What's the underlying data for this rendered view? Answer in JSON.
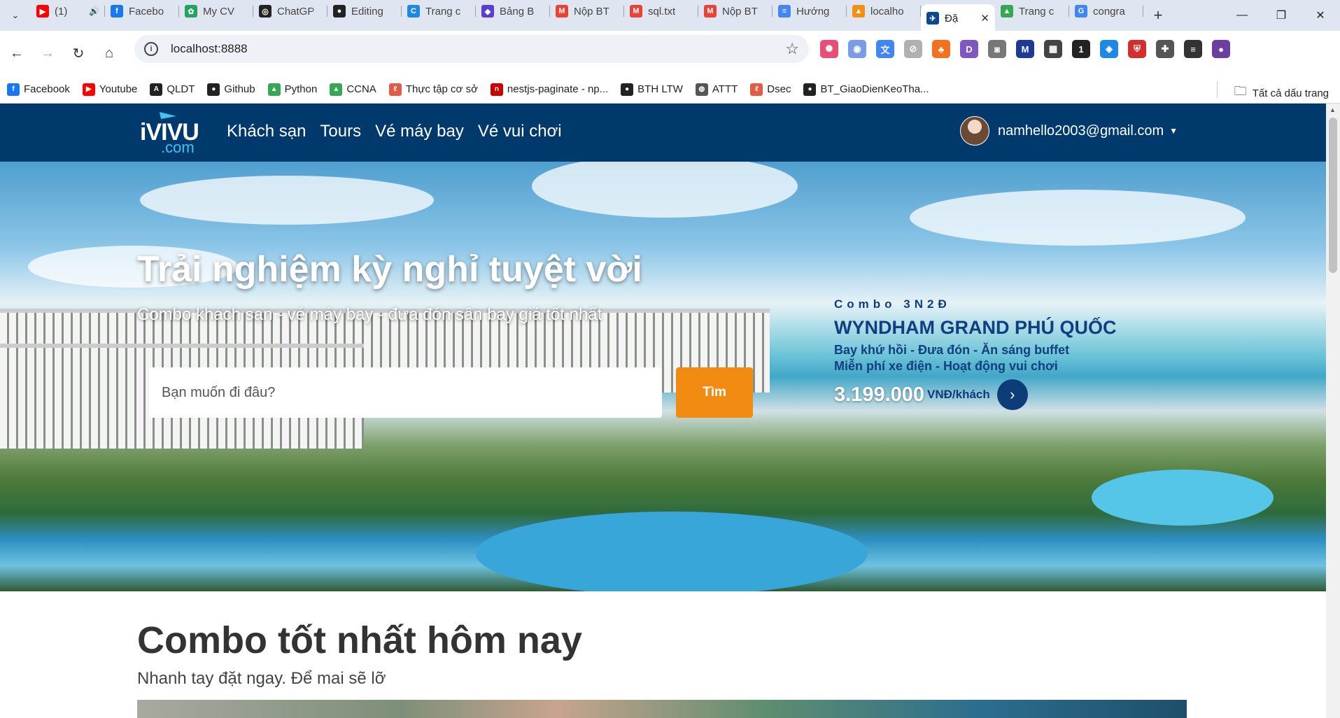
{
  "browser": {
    "tabs": [
      {
        "title": "(1)",
        "icon": "youtube-icon",
        "color": "#ff0000",
        "glyph": "▶",
        "audio": true
      },
      {
        "title": "Facebo",
        "icon": "facebook-icon",
        "color": "#1877f2",
        "glyph": "f"
      },
      {
        "title": "My CV",
        "icon": "leaf-icon",
        "color": "#21a366",
        "glyph": "✿"
      },
      {
        "title": "ChatGP",
        "icon": "chatgpt-icon",
        "color": "#222222",
        "glyph": "◎"
      },
      {
        "title": "Editing",
        "icon": "github-icon",
        "color": "#222222",
        "glyph": "●"
      },
      {
        "title": "Trang c",
        "icon": "canva-icon",
        "color": "#1e88e5",
        "glyph": "C"
      },
      {
        "title": "Bảng B",
        "icon": "app-icon",
        "color": "#5b3fd1",
        "glyph": "◆"
      },
      {
        "title": "Nộp BT",
        "icon": "gmail-icon",
        "color": "#ea4335",
        "glyph": "M"
      },
      {
        "title": "sql.txt",
        "icon": "gmail-icon",
        "color": "#ea4335",
        "glyph": "M"
      },
      {
        "title": "Nộp BT",
        "icon": "gmail-icon",
        "color": "#ea4335",
        "glyph": "M"
      },
      {
        "title": "Hướng",
        "icon": "docs-icon",
        "color": "#4285f4",
        "glyph": "≡"
      },
      {
        "title": "localho",
        "icon": "phpmyadmin-icon",
        "color": "#f29111",
        "glyph": "▲"
      },
      {
        "title": "Đặ",
        "icon": "ivivu-icon",
        "color": "#0b4a8b",
        "glyph": "✈",
        "active": true
      },
      {
        "title": "Trang c",
        "icon": "drive-icon",
        "color": "#34a853",
        "glyph": "▲"
      },
      {
        "title": "congra",
        "icon": "google-icon",
        "color": "#4285f4",
        "glyph": "G"
      }
    ],
    "url": "localhost:8888",
    "extensions": [
      {
        "icon": "color-wheel-icon",
        "color": "#e94e77",
        "glyph": "✺"
      },
      {
        "icon": "lens-icon",
        "color": "#7b9be8",
        "glyph": "◉"
      },
      {
        "icon": "translate-icon",
        "color": "#4285f4",
        "glyph": "文"
      },
      {
        "icon": "compass-icon",
        "color": "#b0b0b0",
        "glyph": "⊘"
      },
      {
        "icon": "fox-icon",
        "color": "#f2711c",
        "glyph": "♣"
      },
      {
        "icon": "d-icon",
        "color": "#7e57c2",
        "glyph": "D"
      },
      {
        "icon": "camera-icon",
        "color": "#777777",
        "glyph": "◙"
      },
      {
        "icon": "m-icon",
        "color": "#1f3a93",
        "glyph": "M"
      },
      {
        "icon": "qr-icon",
        "color": "#444444",
        "glyph": "▦"
      },
      {
        "icon": "inbox-icon",
        "color": "#222222",
        "glyph": "1"
      },
      {
        "icon": "tag-icon",
        "color": "#1e88e5",
        "glyph": "◈"
      },
      {
        "icon": "shield-icon",
        "color": "#d32f2f",
        "glyph": "⛨"
      },
      {
        "icon": "puzzle-icon",
        "color": "#555555",
        "glyph": "✚"
      },
      {
        "icon": "media-icon",
        "color": "#333333",
        "glyph": "≡"
      },
      {
        "icon": "profile-icon",
        "color": "#6a3fa0",
        "glyph": "●"
      }
    ],
    "bookmarks": [
      {
        "label": "Facebook",
        "icon": "facebook-icon",
        "color": "#1877f2",
        "glyph": "f"
      },
      {
        "label": "Youtube",
        "icon": "youtube-icon",
        "color": "#ff0000",
        "glyph": "▶"
      },
      {
        "label": "QLDT",
        "icon": "angular-icon",
        "color": "#222222",
        "glyph": "A"
      },
      {
        "label": "Github",
        "icon": "github-icon",
        "color": "#222222",
        "glyph": "●"
      },
      {
        "label": "Python",
        "icon": "drive-icon",
        "color": "#34a853",
        "glyph": "▲"
      },
      {
        "label": "CCNA",
        "icon": "drive-icon",
        "color": "#34a853",
        "glyph": "▲"
      },
      {
        "label": "Thực tập cơ sở",
        "icon": "quill-icon",
        "color": "#e25b45",
        "glyph": "ℓ"
      },
      {
        "label": "nestjs-paginate - np...",
        "icon": "npm-icon",
        "color": "#cb0000",
        "glyph": "n"
      },
      {
        "label": "BTH LTW",
        "icon": "github-icon",
        "color": "#222222",
        "glyph": "●"
      },
      {
        "label": "ATTT",
        "icon": "globe-icon",
        "color": "#555555",
        "glyph": "◍"
      },
      {
        "label": "Dsec",
        "icon": "quill-icon",
        "color": "#e25b45",
        "glyph": "ℓ"
      },
      {
        "label": "BT_GiaoDienKeoTha...",
        "icon": "github-icon",
        "color": "#222222",
        "glyph": "●"
      }
    ],
    "all_bookmarks": "Tất cả dấu trang"
  },
  "site": {
    "logo_top": "iVIVU",
    "logo_bottom": ".com",
    "nav": [
      "Khách sạn",
      "Tours",
      "Vé máy bay",
      "Vé vui chơi"
    ],
    "user_email": "namhello2003@gmail.com",
    "hero_title": "Trải nghiệm kỳ nghỉ tuyệt vời",
    "hero_subtitle": "Combo khách sạn - vé máy bay - đưa đón sân bay giá tốt nhất",
    "search_placeholder": "Bạn muốn đi đâu?",
    "search_button": "Tìm",
    "promo": {
      "label": "Combo 3N2Đ",
      "name": "WYNDHAM GRAND PHÚ QUỐC",
      "line1": "Bay khứ hồi - Đưa đón - Ăn sáng buffet",
      "line2": "Miễn phí xe điện - Hoạt động vui chơi",
      "price": "3.199.000",
      "unit": "VNĐ/khách"
    },
    "section_title": "Combo tốt nhất hôm nay",
    "section_subtitle": "Nhanh tay đặt ngay. Để mai sẽ lỡ"
  },
  "colors": {
    "navbar": "#00396b",
    "search_button": "#f18b12",
    "tabbar": "#dfe6f2"
  }
}
